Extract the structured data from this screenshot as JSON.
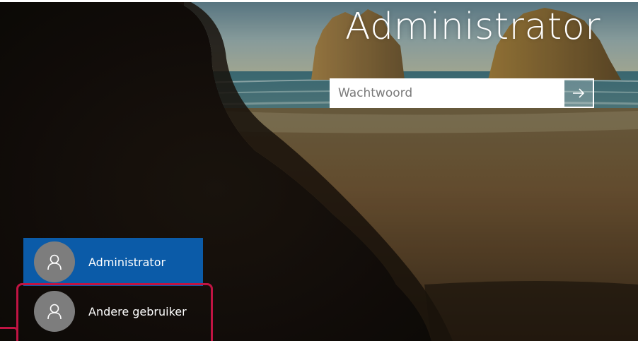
{
  "lock_screen": {
    "user_name": "Administrator",
    "password_placeholder": "Wachtwoord",
    "submit_icon": "arrow-right-icon"
  },
  "user_switcher": {
    "users": [
      {
        "label": "Administrator",
        "icon": "user-icon",
        "selected": true
      },
      {
        "label": "Andere gebruiker",
        "icon": "user-icon",
        "selected": false
      }
    ]
  },
  "colors": {
    "accent": "#0b5ba8",
    "highlight": "#c01443",
    "avatar": "#7d7d7d"
  }
}
